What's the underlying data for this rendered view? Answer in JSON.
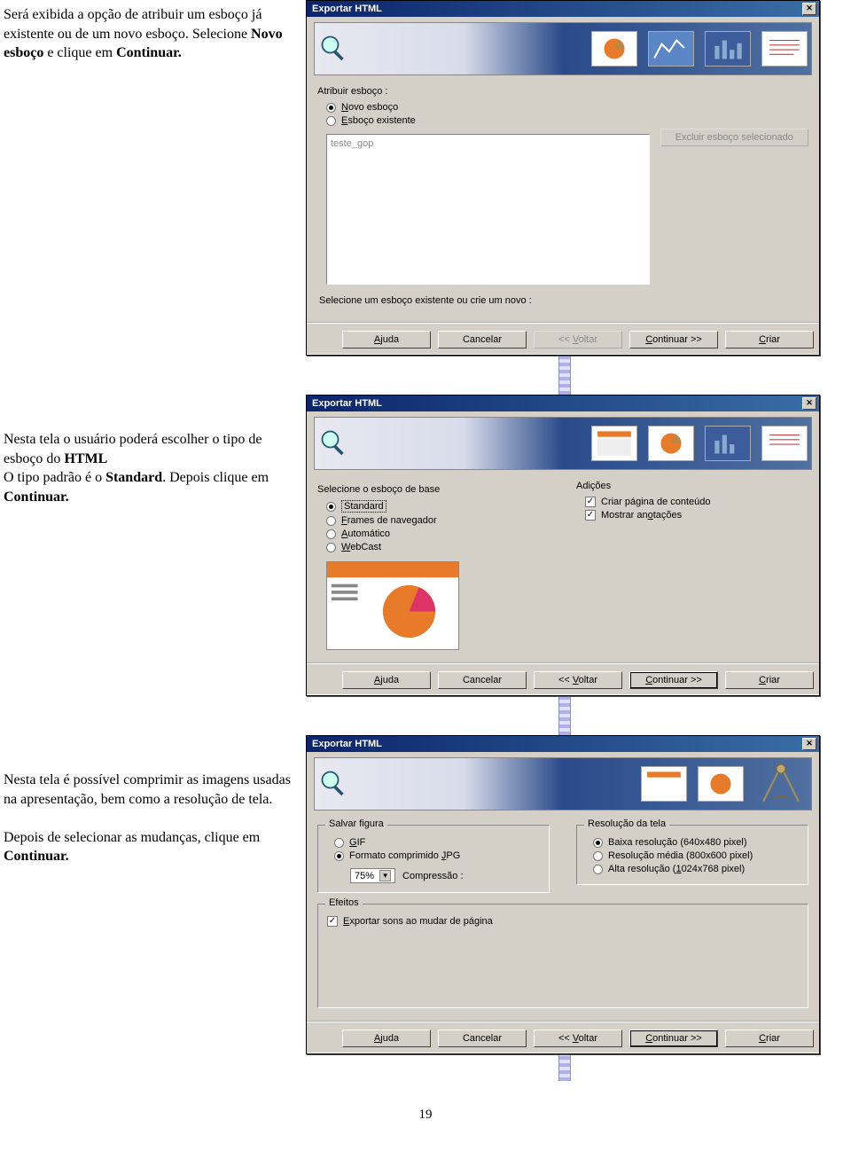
{
  "page_number": "19",
  "para1": {
    "t1": "Será exibida a opção de atribuir um esboço já existente ou de um novo esboço. Selecione ",
    "b1": "Novo esboço",
    "t2": " e clique em ",
    "b2": "Continuar."
  },
  "para2": {
    "t1": "Nesta tela o usuário poderá escolher o tipo de esboço do ",
    "b1": "HTML",
    "t2": "O tipo padrão é o ",
    "b2": "Standard",
    "t3": ". Depois clique em ",
    "b3": "Continuar."
  },
  "para3": {
    "t1": "Nesta tela é possível comprimir as imagens usadas na apresentação, bem como a resolução de tela.",
    "t2": "Depois de selecionar as mudanças, clique em ",
    "b1": "Continuar."
  },
  "dlg": {
    "title": "Exportar HTML",
    "help": "Ajuda",
    "cancel": "Cancelar",
    "back": "<< Voltar",
    "next": "Continuar >>",
    "create": "Criar"
  },
  "d1": {
    "assign": "Atribuir esboço :",
    "r1_pre": "N",
    "r1_post": "ovo esboço",
    "r2_pre": "E",
    "r2_post": "sboço existente",
    "list_item": "teste_gop",
    "delbtn": "Excluir esboço selecionado",
    "hint": "Selecione um esboço existente ou crie um novo :"
  },
  "d2": {
    "grp1": "Selecione o esboço de base",
    "grp2": "Adições",
    "std": "Standard",
    "frames_pre": "F",
    "frames_post": "rames de navegador",
    "auto_pre": "A",
    "auto_post": "utomático",
    "webcast_pre": "W",
    "webcast_post": "ebCast",
    "c1": "Criar página de conteúdo",
    "c2_pre": "Mostrar an",
    "c2_u": "o",
    "c2_post": "tações"
  },
  "d3": {
    "grp1": "Salvar figura",
    "grp2": "Resolução da tela",
    "gif_pre": "G",
    "gif_post": "IF",
    "jpg_pre": "Formato comprimido ",
    "jpg_u": "J",
    "jpg_post": "PG",
    "comp_val": "75%",
    "comp_label": "Compressão :",
    "res1": "Baixa resolução (640x480 pixel)",
    "res2": "Resolução média (800x600 pixel)",
    "res3_pre": "Alta resolução (",
    "res3_u": "1",
    "res3_post": "024x768 pixel)",
    "eff_grp": "Efeitos",
    "eff_pre": "E",
    "eff_post": "xportar sons ao mudar de página"
  }
}
